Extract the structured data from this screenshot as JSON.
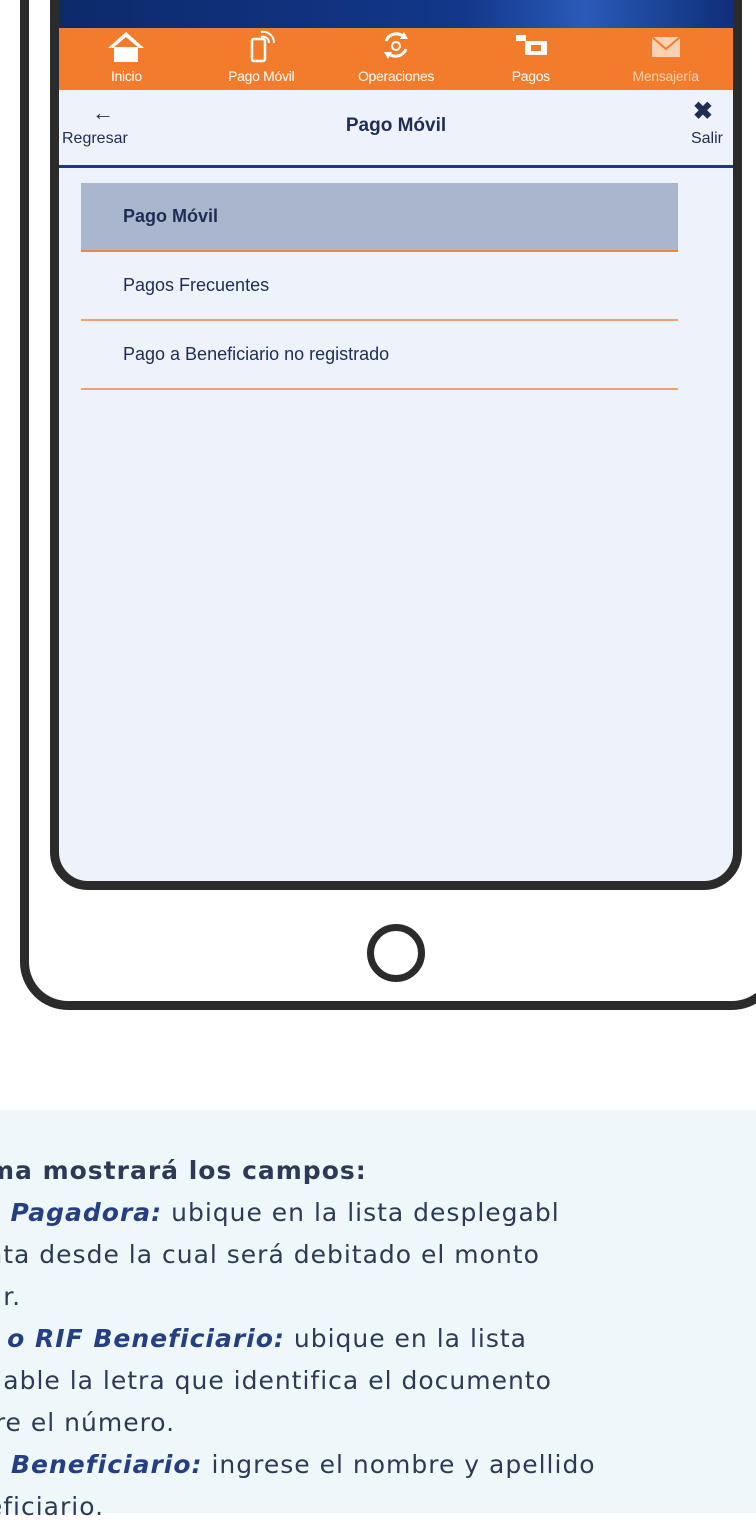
{
  "nav": {
    "items": [
      {
        "label": "Inicio",
        "icon": "home-icon"
      },
      {
        "label": "Pago Móvil",
        "icon": "mobile-payment-icon"
      },
      {
        "label": "Operaciones",
        "icon": "operations-icon"
      },
      {
        "label": "Pagos",
        "icon": "payments-icon"
      },
      {
        "label": "Mensajería",
        "icon": "envelope-icon"
      }
    ]
  },
  "header": {
    "back_label": "Regresar",
    "title": "Pago Móvil",
    "exit_label": "Salir"
  },
  "menu": {
    "items": [
      {
        "label": "Pago Móvil",
        "active": true
      },
      {
        "label": "Pagos Frecuentes",
        "active": false
      },
      {
        "label": "Pago a Beneficiario no registrado",
        "active": false
      }
    ]
  },
  "info": {
    "heading": "ema mostrará los campos:",
    "line1_term": "ta Pagadora:",
    "line1_rest": " ubique en la lista desplegabl",
    "line2": "enta desde la cual será debitado el monto",
    "line3": "gar.",
    "line4_term": "la o RIF Beneficiario:",
    "line4_rest": " ubique en la lista",
    "line5": "egable la letra que identifica el documento",
    "line6": "stre el número.",
    "line7_term": "re Beneficiario:",
    "line7_rest": " ingrese el nombre y apellido",
    "line8": "neficiario."
  },
  "colors": {
    "nav_orange": "#f27c2b",
    "top_blue": "#13378a",
    "active_item": "#a9b6cc",
    "text_dark": "#1e2d54"
  }
}
